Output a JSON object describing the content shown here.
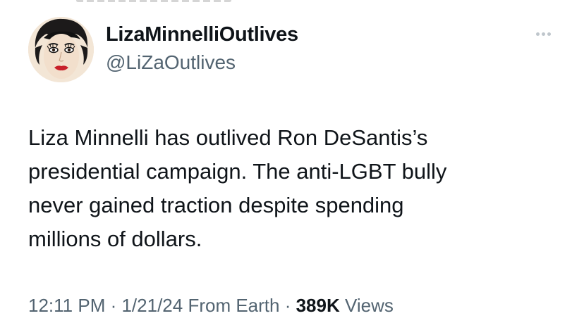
{
  "tweet": {
    "author": {
      "display_name": "LizaMinnelliOutlives",
      "handle": "@LiZaOutlives",
      "avatar_alt": "avatar"
    },
    "more_icon": "more-dots-icon",
    "text_lines": [
      "Liza Minnelli has outlived Ron DeSantis’s",
      "presidential campaign. The anti-LGBT bully",
      "never gained traction despite spending",
      "millions of dollars."
    ],
    "meta": {
      "time": "12:11 PM",
      "separator": " · ",
      "date": "1/21/24",
      "source": "From Earth",
      "views_count": "389K",
      "views_label": " Views"
    }
  },
  "colors": {
    "text_primary": "#0f1419",
    "text_secondary": "#536471",
    "background": "#ffffff"
  }
}
